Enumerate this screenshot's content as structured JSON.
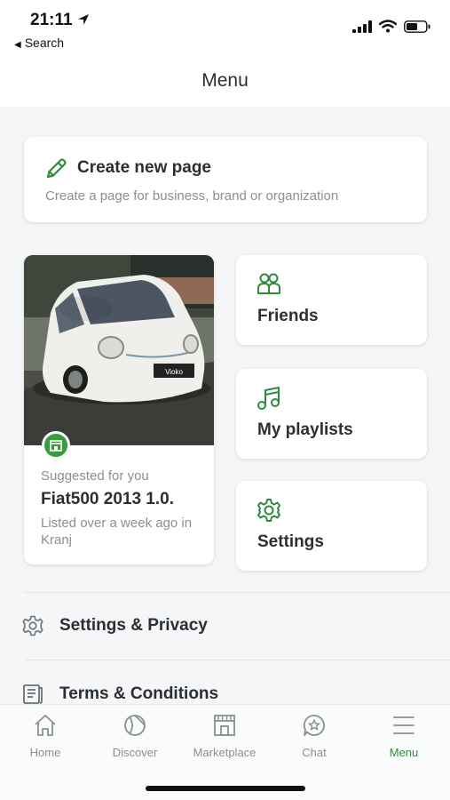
{
  "status": {
    "time": "21:11",
    "back_label": "Search"
  },
  "nav": {
    "title": "Menu"
  },
  "create_page": {
    "title": "Create new page",
    "subtitle": "Create a page for business, brand or organization",
    "icon": "pencil-icon"
  },
  "suggestion": {
    "label": "Suggested for you",
    "title": "Fiat500 2013 1.0.",
    "meta": "Listed over a week ago in Kranj",
    "badge_icon": "marketplace-icon",
    "plate_text": "Vioko"
  },
  "tiles": [
    {
      "label": "Friends",
      "icon": "friends-icon"
    },
    {
      "label": "My playlists",
      "icon": "music-note-icon"
    },
    {
      "label": "Settings",
      "icon": "gear-icon"
    }
  ],
  "rows": [
    {
      "label": "Settings & Privacy",
      "icon": "gear-outline-icon"
    },
    {
      "label": "Terms & Conditions",
      "icon": "document-icon"
    }
  ],
  "tabbar": {
    "items": [
      {
        "label": "Home",
        "icon": "home-icon",
        "active": false
      },
      {
        "label": "Discover",
        "icon": "ball-icon",
        "active": false
      },
      {
        "label": "Marketplace",
        "icon": "storefront-icon",
        "active": false
      },
      {
        "label": "Chat",
        "icon": "chat-star-icon",
        "active": false
      },
      {
        "label": "Menu",
        "icon": "menu-icon",
        "active": true
      }
    ]
  },
  "colors": {
    "accent": "#2e8b3a",
    "text": "#2b2f33",
    "muted": "#8a8f94",
    "background": "#f4f6f7"
  }
}
